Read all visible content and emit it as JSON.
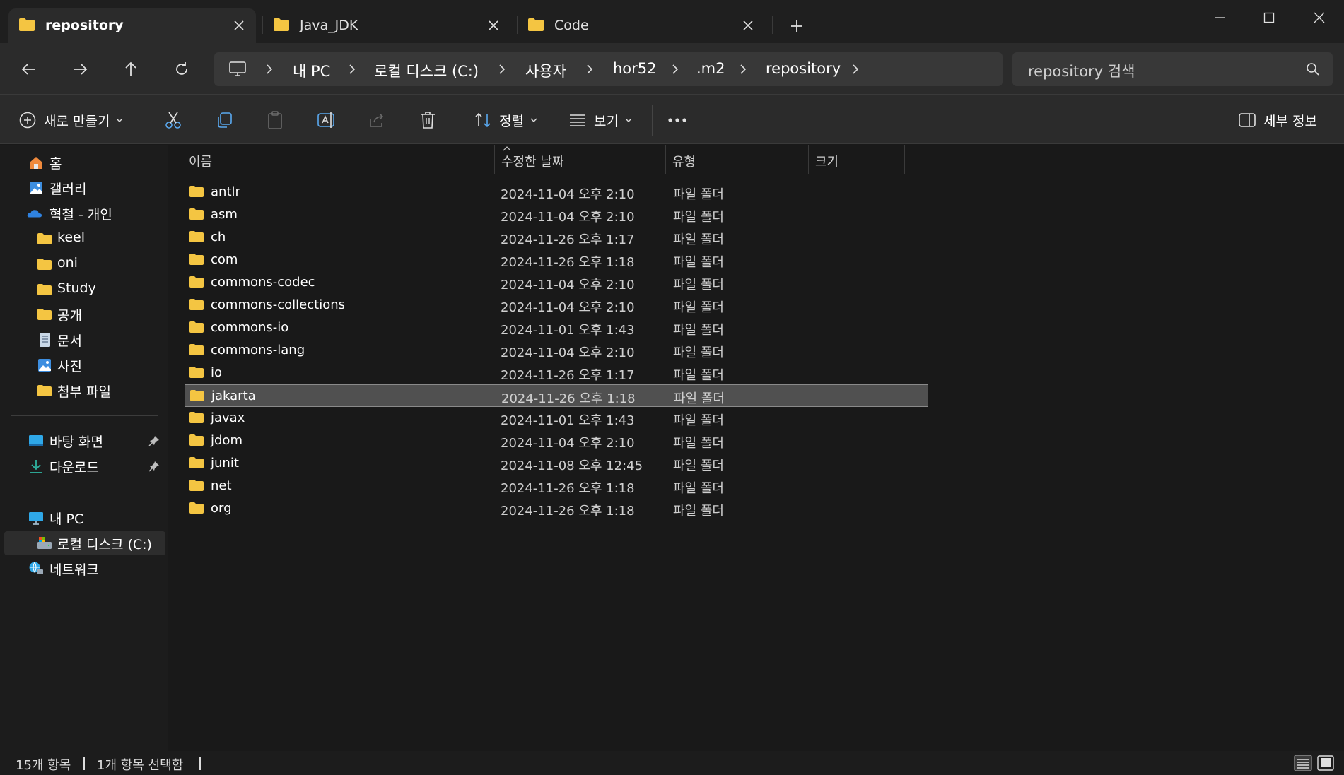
{
  "tabs": [
    {
      "label": "repository",
      "active": true
    },
    {
      "label": "Java_JDK",
      "active": false
    },
    {
      "label": "Code",
      "active": false
    }
  ],
  "window_controls": {
    "minimize": "minimize-icon",
    "maximize": "maximize-icon",
    "close": "close-icon"
  },
  "breadcrumb": [
    "내 PC",
    "로컬 디스크 (C:)",
    "사용자",
    "hor52",
    ".m2",
    "repository"
  ],
  "search": {
    "placeholder": "repository 검색"
  },
  "toolbar": {
    "new_label": "새로 만들기",
    "sort_label": "정렬",
    "view_label": "보기",
    "details_label": "세부 정보"
  },
  "sidebar": {
    "top": [
      {
        "label": "홈",
        "icon": "home-icon"
      },
      {
        "label": "갤러리",
        "icon": "gallery-icon"
      },
      {
        "label": "혁철 - 개인",
        "icon": "onedrive-icon"
      }
    ],
    "folders": [
      {
        "label": "keel",
        "icon": "folder-icon"
      },
      {
        "label": "oni",
        "icon": "folder-icon"
      },
      {
        "label": "Study",
        "icon": "folder-icon"
      },
      {
        "label": "공개",
        "icon": "folder-icon"
      },
      {
        "label": "문서",
        "icon": "document-icon"
      },
      {
        "label": "사진",
        "icon": "pictures-icon"
      },
      {
        "label": "첨부 파일",
        "icon": "folder-icon"
      }
    ],
    "pinned": [
      {
        "label": "바탕 화면",
        "icon": "desktop-icon"
      },
      {
        "label": "다운로드",
        "icon": "download-icon"
      }
    ],
    "pc": [
      {
        "label": "내 PC",
        "icon": "pc-icon"
      },
      {
        "label": "로컬 디스크 (C:)",
        "icon": "drive-icon",
        "selected": true
      },
      {
        "label": "네트워크",
        "icon": "network-icon"
      }
    ]
  },
  "columns": {
    "name": "이름",
    "modified": "수정한 날짜",
    "type": "유형",
    "size": "크기"
  },
  "files": [
    {
      "name": "antlr",
      "modified": "2024-11-04 오후 2:10",
      "type": "파일 폴더"
    },
    {
      "name": "asm",
      "modified": "2024-11-04 오후 2:10",
      "type": "파일 폴더"
    },
    {
      "name": "ch",
      "modified": "2024-11-26 오후 1:17",
      "type": "파일 폴더"
    },
    {
      "name": "com",
      "modified": "2024-11-26 오후 1:18",
      "type": "파일 폴더"
    },
    {
      "name": "commons-codec",
      "modified": "2024-11-04 오후 2:10",
      "type": "파일 폴더"
    },
    {
      "name": "commons-collections",
      "modified": "2024-11-04 오후 2:10",
      "type": "파일 폴더"
    },
    {
      "name": "commons-io",
      "modified": "2024-11-01 오후 1:43",
      "type": "파일 폴더"
    },
    {
      "name": "commons-lang",
      "modified": "2024-11-04 오후 2:10",
      "type": "파일 폴더"
    },
    {
      "name": "io",
      "modified": "2024-11-26 오후 1:17",
      "type": "파일 폴더"
    },
    {
      "name": "jakarta",
      "modified": "2024-11-26 오후 1:18",
      "type": "파일 폴더",
      "selected": true
    },
    {
      "name": "javax",
      "modified": "2024-11-01 오후 1:43",
      "type": "파일 폴더"
    },
    {
      "name": "jdom",
      "modified": "2024-11-04 오후 2:10",
      "type": "파일 폴더"
    },
    {
      "name": "junit",
      "modified": "2024-11-08 오후 12:45",
      "type": "파일 폴더"
    },
    {
      "name": "net",
      "modified": "2024-11-26 오후 1:18",
      "type": "파일 폴더"
    },
    {
      "name": "org",
      "modified": "2024-11-26 오후 1:18",
      "type": "파일 폴더"
    }
  ],
  "status": {
    "count": "15개 항목",
    "selected": "1개 항목 선택함"
  },
  "colors": {
    "folder": "#f4c542",
    "accent": "#4aa3f0",
    "selection": "#505050"
  }
}
